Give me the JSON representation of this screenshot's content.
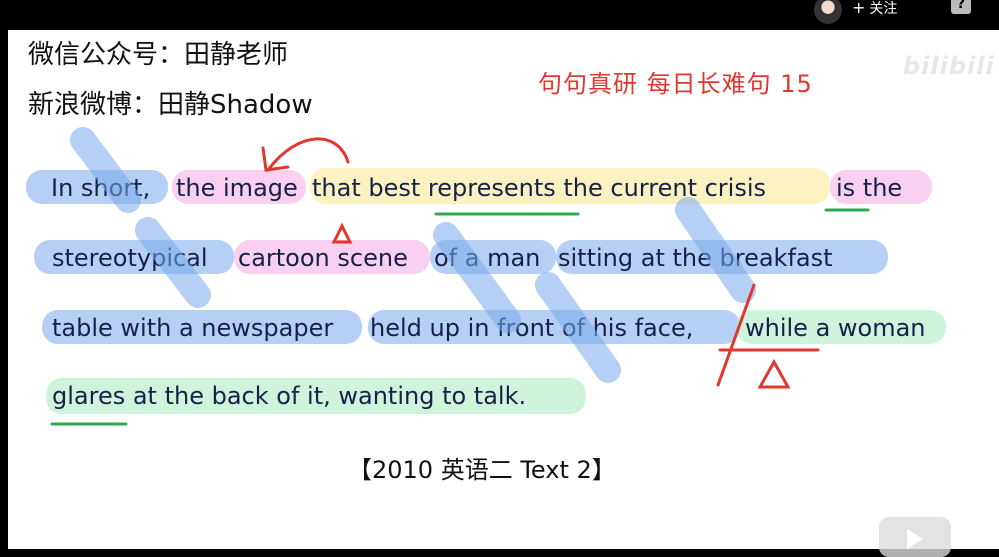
{
  "topbar": {
    "follow_label": "关注",
    "help_label": "?"
  },
  "header": {
    "wechat": "微信公众号：田静老师",
    "weibo": "新浪微博：田静Shadow",
    "series_title": "句句真研 每日长难句 15",
    "watermark": "bilibili"
  },
  "sentence": {
    "line1": [
      "In short,",
      "the image",
      "that best represents the current crisis",
      "is the"
    ],
    "line2": [
      "stereotypical",
      "cartoon scene",
      "of a man",
      "sitting at the breakfast"
    ],
    "line3": [
      "table with a newspaper",
      "held up in front of his face,",
      "while a woman"
    ],
    "line4": [
      "glares at the back of it, wanting to talk."
    ]
  },
  "source": "【2010 英语二 Text 2】",
  "colors": {
    "blue": "#78aaeb",
    "pink": "#f5aae6",
    "yellow": "#fae68c",
    "green": "#aaebbe",
    "red": "#e0372f"
  }
}
